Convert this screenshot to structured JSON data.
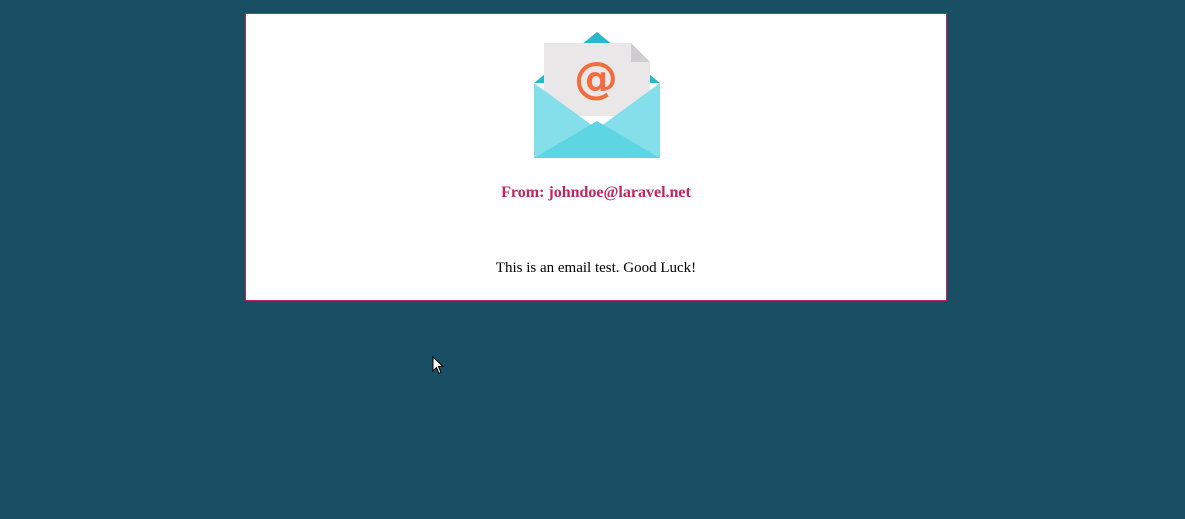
{
  "email": {
    "from_prefix": "From: ",
    "from_address": "johndoe@laravel.net",
    "message": "This is an email test. Good Luck!",
    "icon": "open-envelope-at-icon"
  },
  "colors": {
    "background": "#184f64",
    "accent": "#c0255e",
    "envelope_light": "#85dfea",
    "envelope_dark": "#29b8c9",
    "at_symbol": "#f26c3e"
  }
}
